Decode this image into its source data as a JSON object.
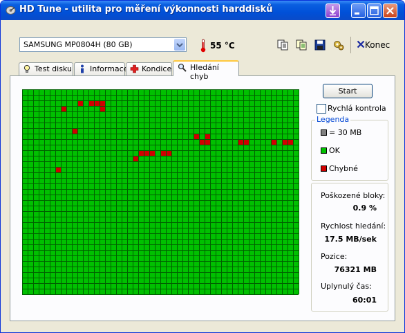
{
  "window": {
    "title": "HD Tune - utilita pro měření výkonnosti harddisků",
    "title_icon": "hdtune-app-icon",
    "controls": [
      "download-icon",
      "minimize-icon",
      "maximize-icon",
      "close-icon"
    ]
  },
  "toolbar": {
    "drive_selected": "SAMSUNG MP0804H (80 GB)",
    "temperature": "55 °C",
    "icons": [
      "copy-info-icon",
      "copy-text-icon",
      "save-icon",
      "options-icon"
    ],
    "exit_label": "Konec"
  },
  "tabs": [
    {
      "label": "Test disku",
      "icon": "bulb-icon",
      "active": false
    },
    {
      "label": "Informace",
      "icon": "info-icon",
      "active": false
    },
    {
      "label": "Kondice",
      "icon": "cross-icon",
      "active": false
    },
    {
      "label": "Hledání chyb",
      "icon": "magnifier-icon",
      "active": true
    }
  ],
  "controls": {
    "start_label": "Start",
    "quick_scan_label": "Rychlá kontrola",
    "quick_scan_checked": false
  },
  "legend": {
    "title": "Legenda",
    "items": [
      {
        "label": "= 30 MB",
        "color": "#808080"
      },
      {
        "label": "OK",
        "color": "#00c000"
      },
      {
        "label": "Chybné",
        "color": "#d00000"
      }
    ]
  },
  "stats": {
    "damaged_label": "Poškozené bloky:",
    "damaged_value": "0.9 %",
    "speed_label": "Rychlost hledání:",
    "speed_value": "17.5 MB/sek",
    "position_label": "Pozice:",
    "position_value": "76321 MB",
    "elapsed_label": "Uplynulý čas:",
    "elapsed_value": "60:01"
  },
  "block_map": {
    "columns": 50,
    "rows": 37,
    "ok_color": "#00c000",
    "bad_color": "#d00000",
    "line_color": "#006000",
    "bad_blocks": [
      [
        2,
        10
      ],
      [
        2,
        12
      ],
      [
        2,
        13
      ],
      [
        2,
        14
      ],
      [
        3,
        7
      ],
      [
        3,
        14
      ],
      [
        7,
        9
      ],
      [
        8,
        31
      ],
      [
        8,
        33
      ],
      [
        9,
        32
      ],
      [
        9,
        33
      ],
      [
        9,
        39
      ],
      [
        9,
        40
      ],
      [
        9,
        45
      ],
      [
        9,
        47
      ],
      [
        9,
        48
      ],
      [
        11,
        21
      ],
      [
        11,
        22
      ],
      [
        11,
        23
      ],
      [
        11,
        25
      ],
      [
        11,
        26
      ],
      [
        12,
        20
      ],
      [
        14,
        6
      ]
    ]
  }
}
